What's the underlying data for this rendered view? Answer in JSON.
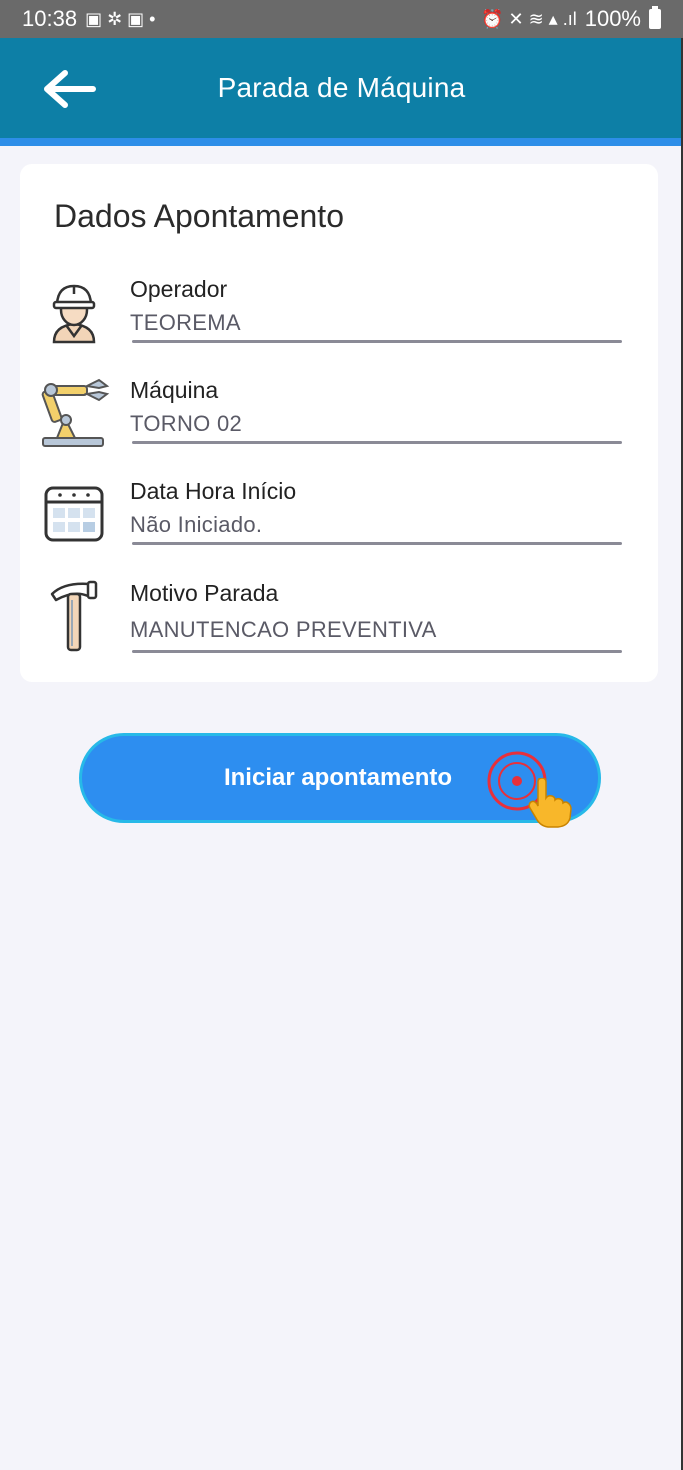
{
  "status_bar": {
    "time": "10:38",
    "battery": "100%",
    "left_glyphs": "▣ ✲ ▣ •",
    "right_glyphs": "⏰ ✕ ≋ ▴ .ıl"
  },
  "app_bar": {
    "title": "Parada de Máquina"
  },
  "card": {
    "title": "Dados Apontamento",
    "fields": [
      {
        "label": "Operador",
        "value": "TEOREMA",
        "icon": "worker-helmet-icon"
      },
      {
        "label": "Máquina",
        "value": "TORNO 02",
        "icon": "robot-arm-icon"
      },
      {
        "label": "Data Hora Início",
        "value": "Não Iniciado.",
        "icon": "calendar-icon"
      },
      {
        "label": "Motivo Parada",
        "value": "MANUTENCAO PREVENTIVA",
        "icon": "hammer-icon"
      }
    ]
  },
  "actions": {
    "start_label": "Iniciar apontamento"
  },
  "colors": {
    "app_bar": "#0d7fa6",
    "accent": "#2d8ee8",
    "button": "#2d8ef0",
    "button_border": "#27b9e8",
    "background": "#f4f4fa"
  }
}
